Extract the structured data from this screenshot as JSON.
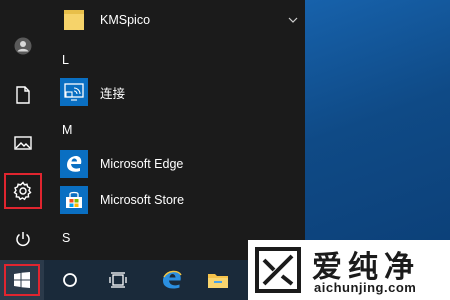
{
  "start_menu": {
    "rail": {
      "user": "user-icon",
      "documents": "document-icon",
      "pictures": "picture-icon",
      "settings": "settings-gear-icon",
      "power": "power-icon"
    },
    "groups": [
      {
        "letter": "",
        "apps": [
          {
            "label": "KMSpico",
            "icon": "folder-icon",
            "expandable": true
          }
        ]
      },
      {
        "letter": "L",
        "apps": [
          {
            "label": "连接",
            "icon": "connect-icon"
          }
        ]
      },
      {
        "letter": "M",
        "apps": [
          {
            "label": "Microsoft Edge",
            "icon": "edge-icon"
          },
          {
            "label": "Microsoft Store",
            "icon": "store-icon"
          }
        ]
      },
      {
        "letter": "S",
        "apps": []
      }
    ]
  },
  "taskbar": {
    "items": [
      "windows-start-icon",
      "search-circle-icon",
      "task-view-icon",
      "edge-icon",
      "file-explorer-icon"
    ]
  },
  "watermark": {
    "title": "爱纯净",
    "url": "aichunjing.com"
  },
  "colors": {
    "menu_bg": "#1b1b1b",
    "tile_blue": "#0a6fc2",
    "highlight_red": "#e0252f",
    "taskbar_bg": "#1a2a3a"
  }
}
